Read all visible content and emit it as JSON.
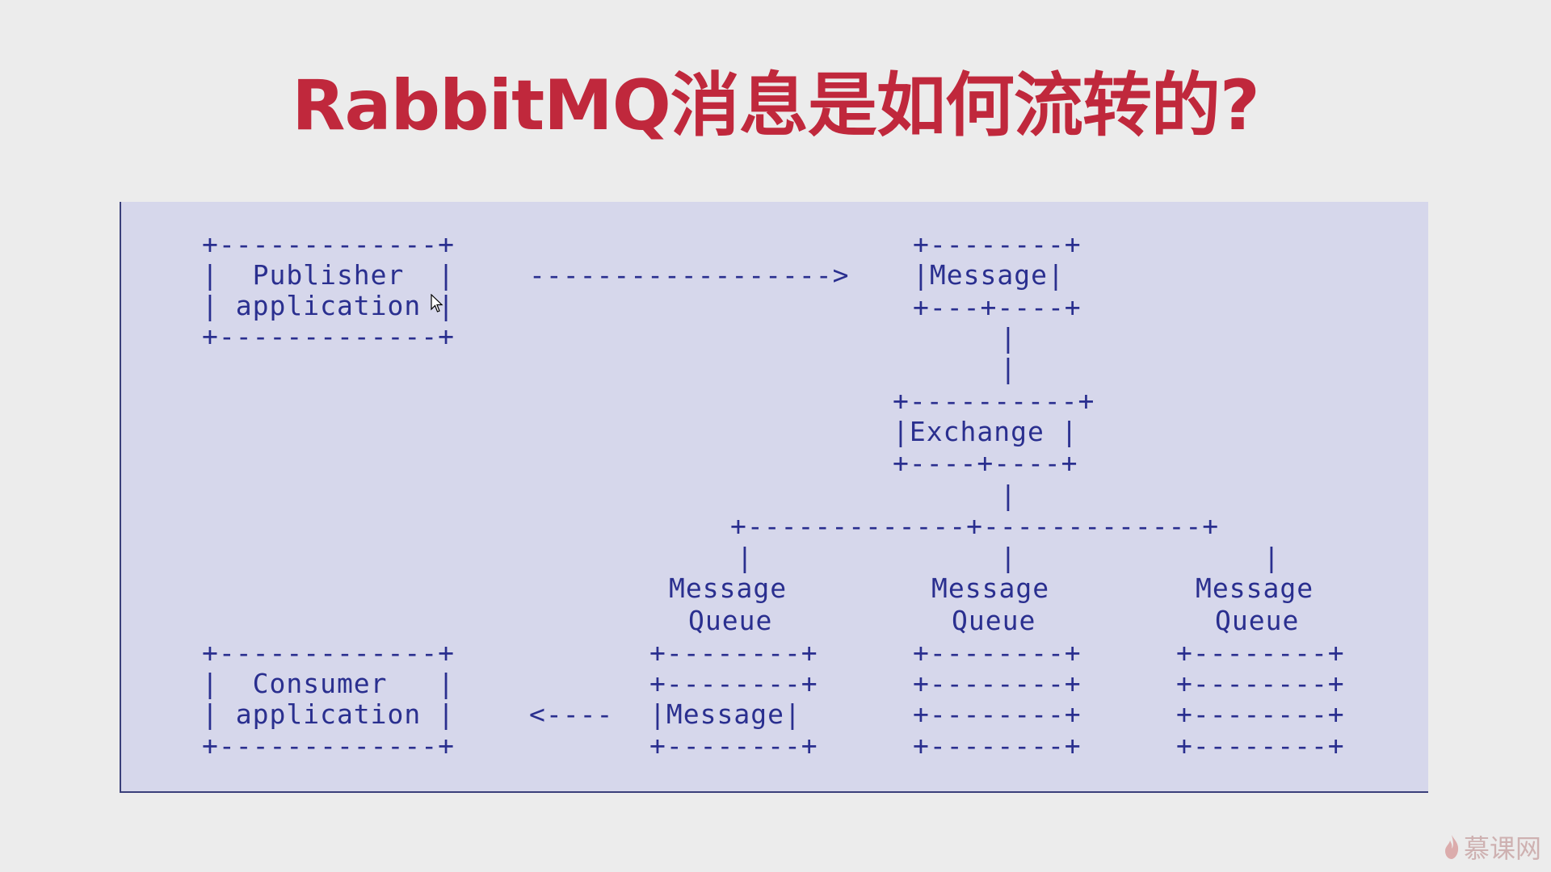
{
  "title": "RabbitMQ消息是如何流转的?",
  "diagram": {
    "publisher_box": {
      "top": "+-------------+",
      "line1": "|  Publisher  |",
      "line2": "| application |",
      "bottom": "+-------------+"
    },
    "publish_arrow": "------------------>",
    "message_box": {
      "top": "+--------+",
      "line1": "|Message|",
      "bottom": "+---+----+"
    },
    "connector_vertical": "|",
    "exchange_box": {
      "top": "+----------+",
      "line1": "|Exchange |",
      "bottom": "+----+----+"
    },
    "fanout_line": "+-------------+-------------+",
    "queues": [
      {
        "label1": "Message",
        "label2": "Queue"
      },
      {
        "label1": "Message",
        "label2": "Queue"
      },
      {
        "label1": "Message",
        "label2": "Queue"
      }
    ],
    "queue_border": "+--------+",
    "queue_message_line": "|Message|",
    "consumer_box": {
      "top": "+-------------+",
      "line1": "|  Consumer   |",
      "line2": "| application |",
      "bottom": "+-------------+"
    },
    "consume_arrow": "<----"
  },
  "watermark": {
    "text": "慕课网",
    "icon": "flame-icon"
  },
  "colors": {
    "title": "#c0283c",
    "diagram_text": "#2a2f8f",
    "panel_background": "#d6d7eb"
  }
}
